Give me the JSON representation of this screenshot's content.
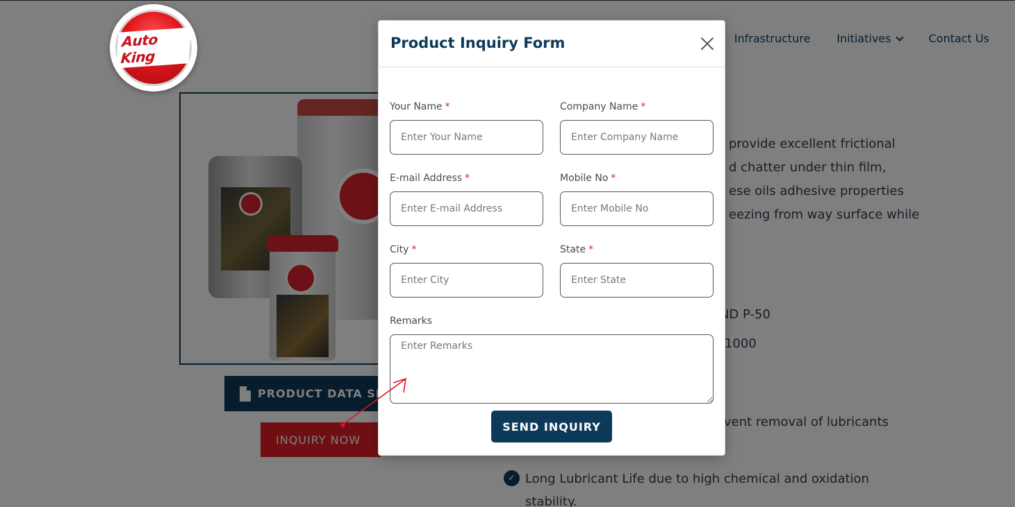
{
  "header": {
    "logo_text": "Auto King",
    "nav": [
      {
        "label": "Infrastructure"
      },
      {
        "label": "Initiatives"
      },
      {
        "label": "Contact Us"
      }
    ]
  },
  "page": {
    "datasheet_button": "PRODUCT DATA SH",
    "inquiry_button": "INQUIRY NOW",
    "description_lines": [
      "provide excellent frictional",
      "d chatter under thin film,",
      "ese oils adhesive properties",
      "eezing from way surface while"
    ],
    "spec_lines": [
      "ND P-50",
      "1000"
    ],
    "benefit_partial": "vent removal of lubricants",
    "benefit_full_1": "Long Lubricant Life due to high chemical and oxidation",
    "benefit_full_2": "stability."
  },
  "modal": {
    "title": "Product Inquiry Form",
    "required_mark": "*",
    "fields": {
      "name": {
        "label": "Your Name",
        "placeholder": "Enter Your Name"
      },
      "company": {
        "label": "Company Name",
        "placeholder": "Enter Company Name"
      },
      "email": {
        "label": "E-mail Address",
        "placeholder": "Enter E-mail Address"
      },
      "mobile": {
        "label": "Mobile No",
        "placeholder": "Enter Mobile No"
      },
      "city": {
        "label": "City",
        "placeholder": "Enter City"
      },
      "state": {
        "label": "State",
        "placeholder": "Enter State"
      },
      "remarks": {
        "label": "Remarks",
        "placeholder": "Enter Remarks"
      }
    },
    "submit_label": "SEND INQUIRY"
  },
  "colors": {
    "brand_navy": "#0e3a5a",
    "brand_red": "#e01e26",
    "annotation_red": "#e0141e"
  }
}
